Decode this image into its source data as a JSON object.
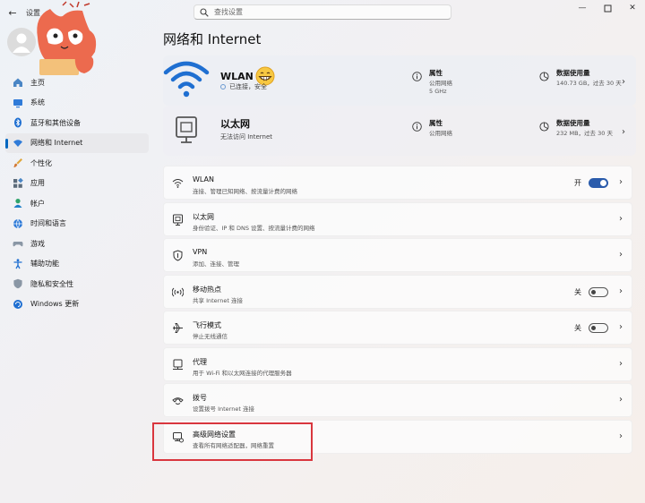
{
  "window": {
    "title": "设置"
  },
  "search": {
    "placeholder": "查找设置"
  },
  "nav": {
    "items": [
      {
        "label": "主页",
        "icon": "home-icon"
      },
      {
        "label": "系统",
        "icon": "system-icon"
      },
      {
        "label": "蓝牙和其他设备",
        "icon": "bluetooth-icon"
      },
      {
        "label": "网络和 Internet",
        "icon": "network-icon",
        "active": true
      },
      {
        "label": "个性化",
        "icon": "brush-icon"
      },
      {
        "label": "应用",
        "icon": "apps-icon"
      },
      {
        "label": "帐户",
        "icon": "account-icon"
      },
      {
        "label": "时间和语言",
        "icon": "globe-clock-icon"
      },
      {
        "label": "游戏",
        "icon": "gamepad-icon"
      },
      {
        "label": "辅助功能",
        "icon": "accessibility-icon"
      },
      {
        "label": "隐私和安全性",
        "icon": "shield-icon"
      },
      {
        "label": "Windows 更新",
        "icon": "update-icon"
      }
    ]
  },
  "page": {
    "title": "网络和 Internet"
  },
  "hero": {
    "wlan": {
      "name": "WLAN",
      "status": "已连接，安全",
      "properties_title": "属性",
      "properties_sub1": "公用网络",
      "properties_sub2": "5 GHz",
      "usage_title": "数据使用量",
      "usage_sub": "140.73 GB，过去 30 天"
    },
    "ethernet": {
      "name": "以太网",
      "status": "无法访问 Internet",
      "properties_title": "属性",
      "properties_sub1": "公用网络",
      "usage_title": "数据使用量",
      "usage_sub": "232 MB，过去 30 天"
    }
  },
  "rows": [
    {
      "title": "WLAN",
      "desc": "连接、管理已知网络、按流量计费的网络",
      "icon": "wifi-icon",
      "toggle": "开",
      "toggle_on": true
    },
    {
      "title": "以太网",
      "desc": "身份验证、IP 和 DNS 设置、按流量计费的网络",
      "icon": "ethernet-icon"
    },
    {
      "title": "VPN",
      "desc": "添加、连接、管理",
      "icon": "vpn-shield-icon"
    },
    {
      "title": "移动热点",
      "desc": "共享 Internet 连接",
      "icon": "hotspot-icon",
      "toggle": "关",
      "toggle_on": false
    },
    {
      "title": "飞行模式",
      "desc": "停止无线通信",
      "icon": "airplane-icon",
      "toggle": "关",
      "toggle_on": false
    },
    {
      "title": "代理",
      "desc": "用于 Wi-Fi 和以太网连接的代理服务器",
      "icon": "proxy-icon"
    },
    {
      "title": "拨号",
      "desc": "设置拨号 Internet 连接",
      "icon": "dialup-icon"
    },
    {
      "title": "高级网络设置",
      "desc": "查看所有网络适配器，网络重置",
      "icon": "advanced-network-icon"
    }
  ],
  "colors": {
    "accent": "#0067c0",
    "toggle_on": "#2a5bab",
    "highlight": "#d9363e"
  }
}
